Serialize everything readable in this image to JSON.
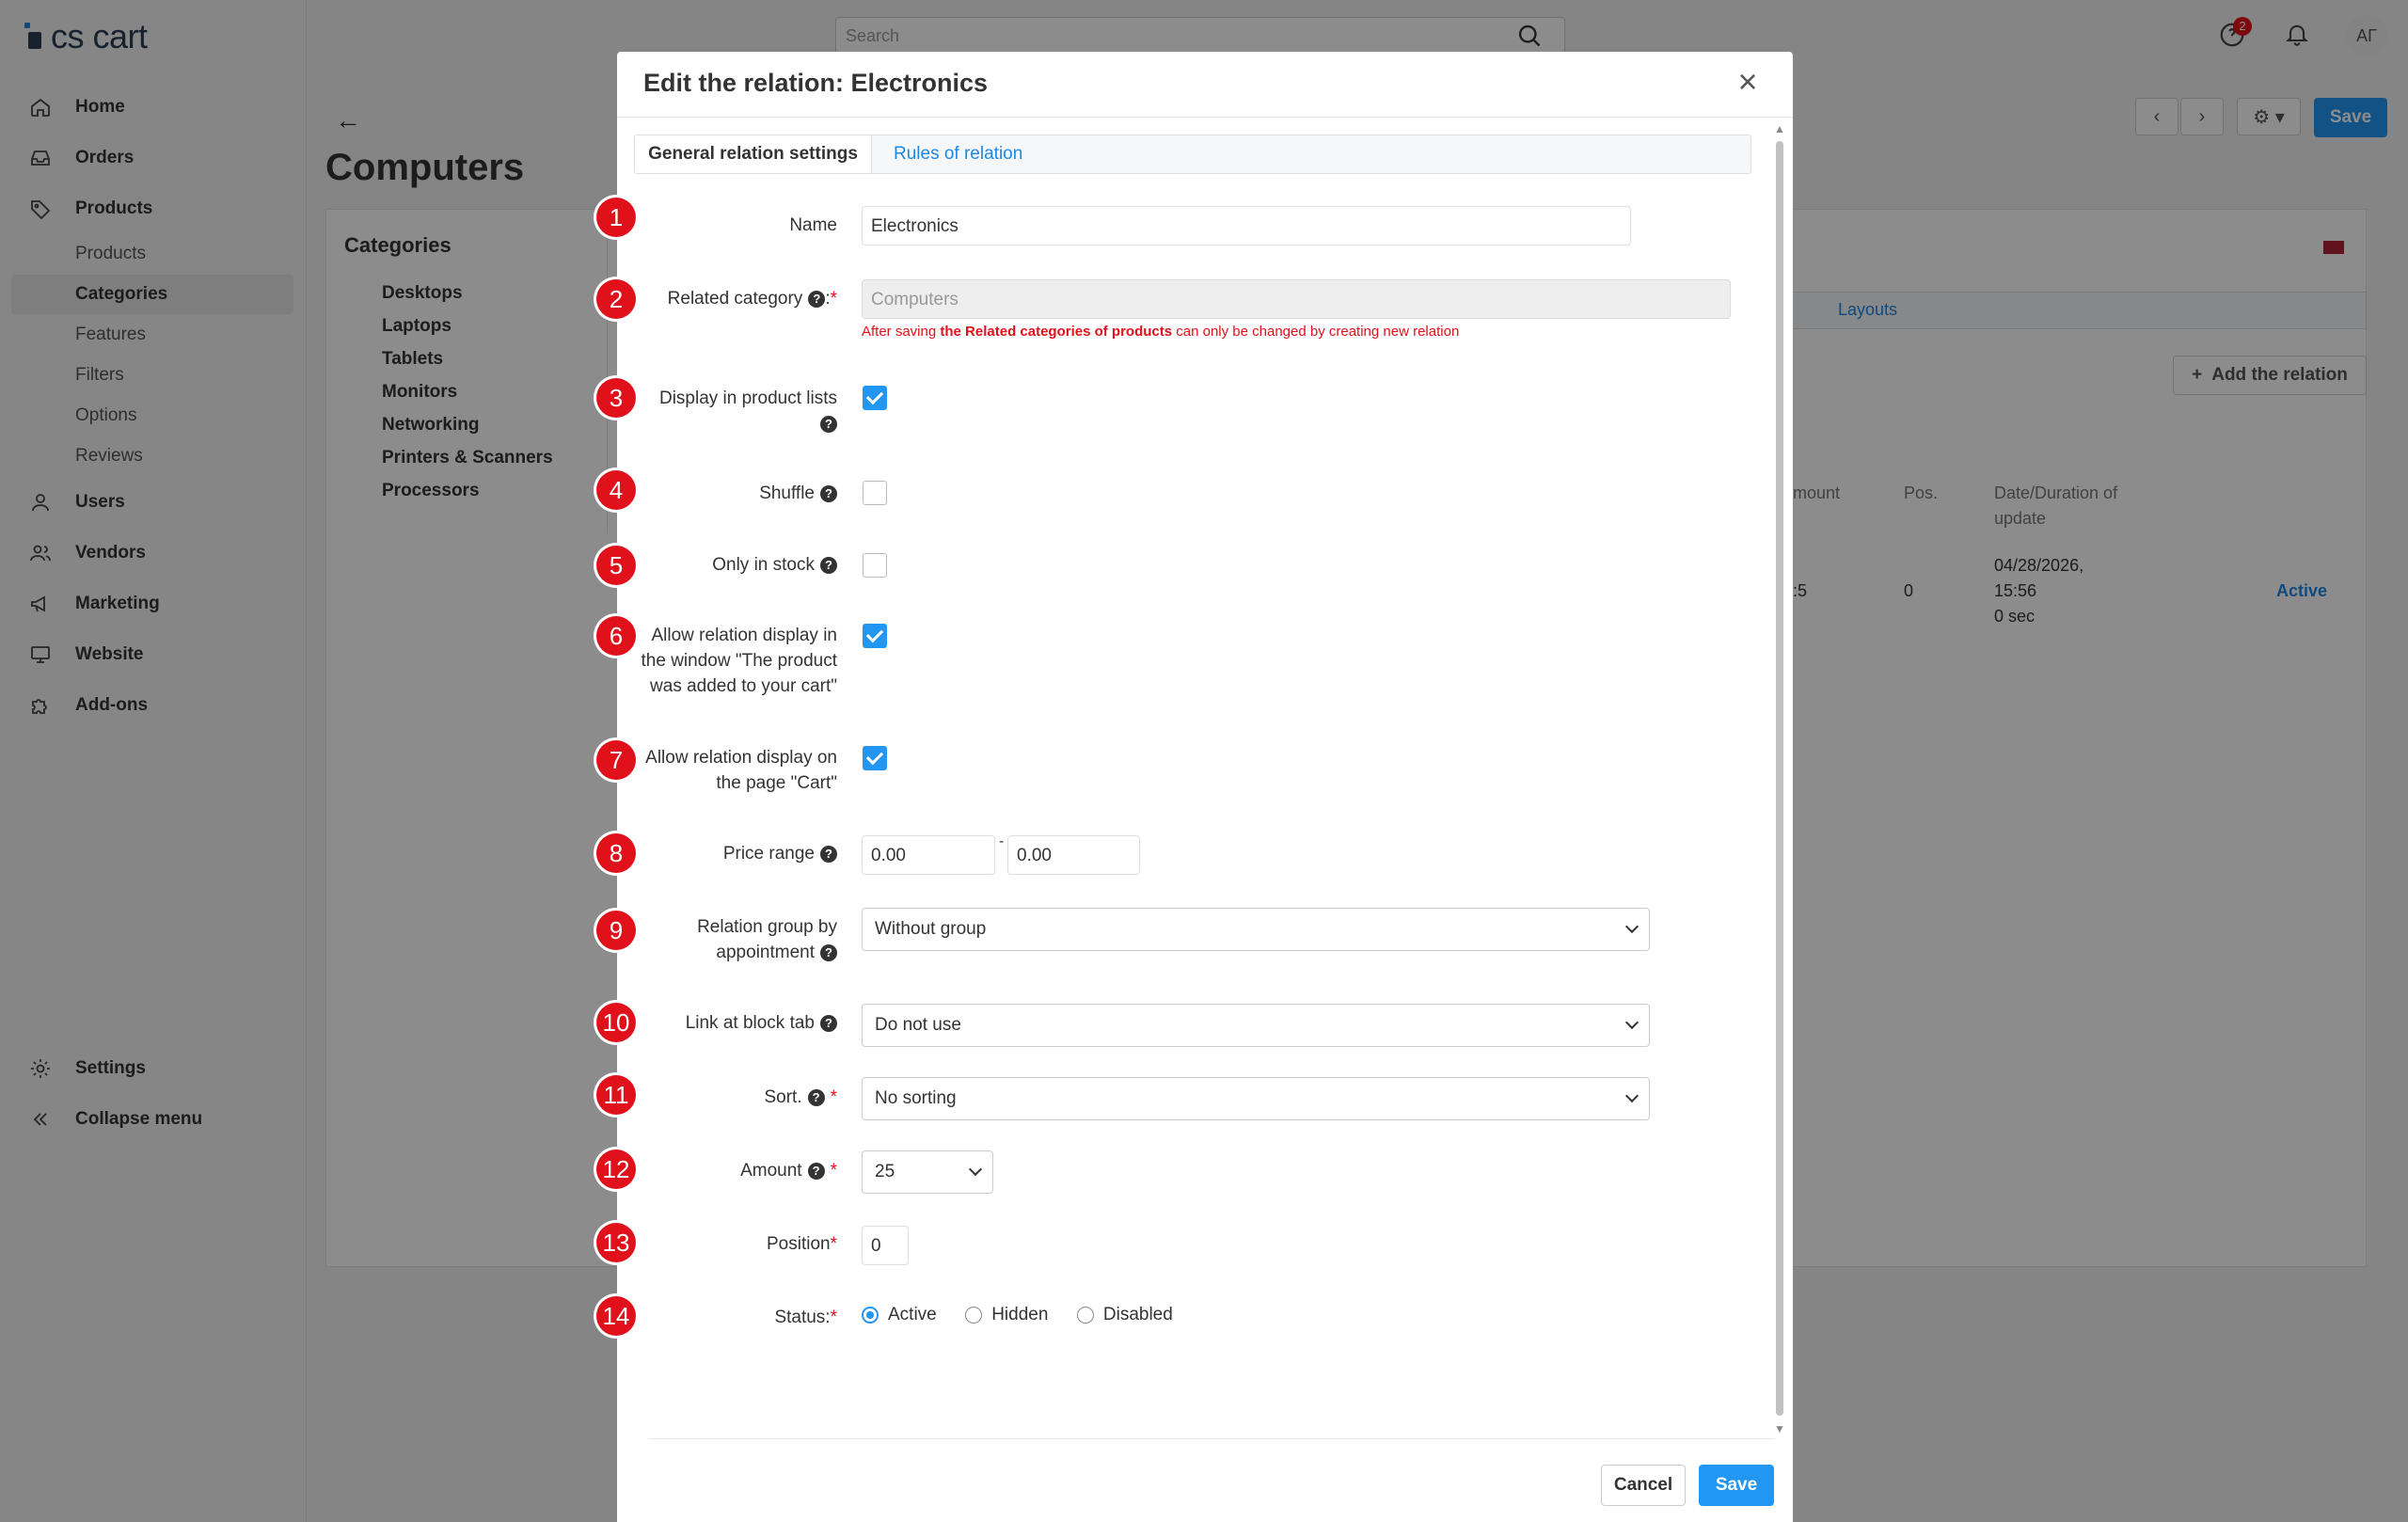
{
  "app": {
    "logo": "cs cart"
  },
  "sidebar": {
    "nav": [
      {
        "label": "Home",
        "icon": "home-icon"
      },
      {
        "label": "Orders",
        "icon": "inbox-icon"
      },
      {
        "label": "Products",
        "icon": "tag-icon"
      }
    ],
    "product_sub": [
      "Products",
      "Categories",
      "Features",
      "Filters",
      "Options",
      "Reviews"
    ],
    "nav2": [
      {
        "label": "Users",
        "icon": "user-icon"
      },
      {
        "label": "Vendors",
        "icon": "users-icon"
      },
      {
        "label": "Marketing",
        "icon": "megaphone-icon"
      },
      {
        "label": "Website",
        "icon": "monitor-icon"
      },
      {
        "label": "Add-ons",
        "icon": "puzzle-icon"
      }
    ],
    "settings": "Settings",
    "collapse": "Collapse menu"
  },
  "header": {
    "search_placeholder": "Search",
    "notification_count": "2",
    "avatar": "АГ",
    "save": "Save"
  },
  "page": {
    "title": "Computers",
    "categories_title": "Categories",
    "categories": [
      "Desktops",
      "Laptops",
      "Tablets",
      "Monitors",
      "Networking",
      "Printers & Scanners",
      "Processors"
    ],
    "layouts_tab": "Layouts",
    "add_relation": "Add the relation",
    "col_amount": "mount",
    "col_pos": "Pos.",
    "col_date": "Date/Duration of",
    "col_date2": "update",
    "row_amount": ":5",
    "row_pos": "0",
    "row_date1": "04/28/2026,",
    "row_date2": "15:56",
    "row_date3": "0 sec",
    "row_status": "Active"
  },
  "modal": {
    "title": "Edit the relation: Electronics",
    "tabs": [
      "General relation settings",
      "Rules of relation"
    ],
    "fields": {
      "name_label": "Name",
      "name_value": "Electronics",
      "related_category_label": "Related category",
      "related_category_suffix": ":",
      "related_category_value": "Computers",
      "note_pre": "After saving ",
      "note_bold": "the Related categories of products",
      "note_post": " can only be changed by creating new relation",
      "display_lists_label": "Display in product lists",
      "shuffle_label": "Shuffle",
      "in_stock_label": "Only in stock",
      "allow_window_l1": "Allow relation display in",
      "allow_window_l2": "the window \"The product",
      "allow_window_l3": "was added to your cart\"",
      "allow_cart_l1": "Allow relation display on",
      "allow_cart_l2": "the page \"Cart\"",
      "price_range_label": "Price range",
      "price_from": "0.00",
      "price_sep": "-",
      "price_to": "0.00",
      "group_l1": "Relation group by",
      "group_l2": "appointment",
      "group_value": "Without group",
      "link_tab_label": "Link at block tab",
      "link_tab_value": "Do not use",
      "sort_label": "Sort.",
      "sort_value": "No sorting",
      "amount_label": "Amount",
      "amount_value": "25",
      "position_label": "Position",
      "position_value": "0",
      "status_label": "Status:",
      "status_options": [
        "Active",
        "Hidden",
        "Disabled"
      ],
      "required_mark": "*"
    },
    "checkbox_state": {
      "display_lists": true,
      "shuffle": false,
      "in_stock": false,
      "allow_window": true,
      "allow_cart": true
    },
    "status_selected": "Active",
    "buttons": {
      "cancel": "Cancel",
      "save": "Save"
    },
    "badges": [
      "1",
      "2",
      "3",
      "4",
      "5",
      "6",
      "7",
      "8",
      "9",
      "10",
      "11",
      "12",
      "13",
      "14"
    ]
  },
  "colors": {
    "accent": "#2196f3",
    "badge": "#e0111a",
    "overlay": "rgba(0,0,0,0.45)"
  }
}
